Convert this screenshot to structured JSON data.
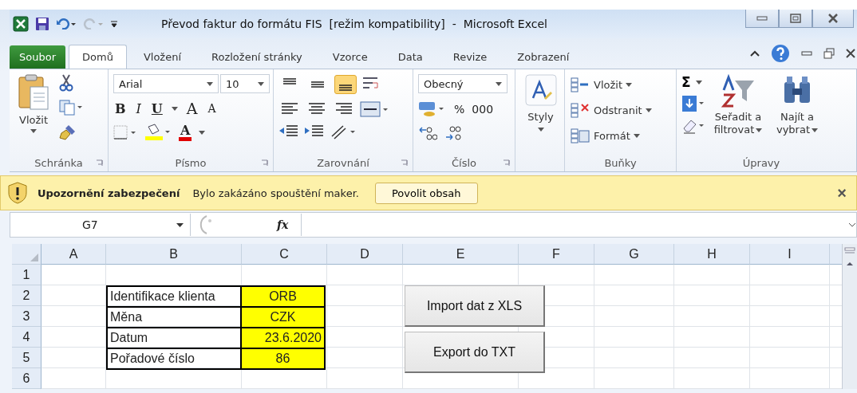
{
  "title_bar": {
    "title": "Převod faktur do formátu FIS  [režim kompatibility]  -  Microsoft Excel"
  },
  "ribbon_tabs": [
    {
      "label": "Soubor",
      "kind": "file",
      "selected": false
    },
    {
      "label": "Domů",
      "kind": "tab",
      "selected": true
    },
    {
      "label": "Vložení",
      "kind": "tab",
      "selected": false
    },
    {
      "label": "Rozložení stránky",
      "kind": "tab",
      "selected": false
    },
    {
      "label": "Vzorce",
      "kind": "tab",
      "selected": false
    },
    {
      "label": "Data",
      "kind": "tab",
      "selected": false
    },
    {
      "label": "Revize",
      "kind": "tab",
      "selected": false
    },
    {
      "label": "Zobrazení",
      "kind": "tab",
      "selected": false
    }
  ],
  "clipboard": {
    "paste": "Vložit",
    "group_label": "Schránka"
  },
  "font": {
    "name": "Arial",
    "size": "10",
    "bold": "B",
    "italic": "I",
    "underline": "U",
    "grow": "A",
    "shrink": "A",
    "color_letter": "A",
    "group_label": "Písmo"
  },
  "alignment": {
    "vertical": [
      {
        "selected": false
      },
      {
        "selected": false
      },
      {
        "selected": true
      }
    ],
    "group_label": "Zarovnání"
  },
  "number": {
    "format": "Obecný",
    "percent": "%",
    "thousands": "000",
    "group_label": "Číslo"
  },
  "styles": {
    "label": "Styly"
  },
  "cells": {
    "items": [
      "Vložit",
      "Odstranit",
      "Formát"
    ],
    "group_label": "Buňky"
  },
  "editing": {
    "sum": "Σ",
    "sort": "Seřadit a filtrovat",
    "find": "Najít a vybrat",
    "group_label": "Úpravy"
  },
  "security_bar": {
    "title": "Upozornění zabezpečení",
    "message": "Bylo zakázáno spouštění maker.",
    "button": "Povolit obsah",
    "close": "×"
  },
  "formula_bar": {
    "name_box": "G7",
    "fx": "fx"
  },
  "sheet": {
    "columns": [
      "A",
      "B",
      "C",
      "D",
      "E",
      "F",
      "G",
      "H",
      "I"
    ],
    "rows": [
      "1",
      "2",
      "3",
      "4",
      "5",
      "6"
    ],
    "table": [
      {
        "label": "Identifikace klienta",
        "value": "ORB",
        "kind": "text"
      },
      {
        "label": "Měna",
        "value": "CZK",
        "kind": "text"
      },
      {
        "label": "Datum",
        "value": "23.6.2020",
        "kind": "date"
      },
      {
        "label": "Pořadové číslo",
        "value": "86",
        "kind": "text"
      }
    ],
    "buttons": [
      "Import dat z XLS",
      "Export do TXT"
    ]
  }
}
